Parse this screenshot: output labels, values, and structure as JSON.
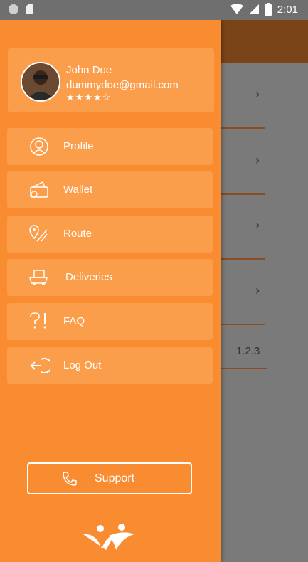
{
  "status_bar": {
    "time": "2:01"
  },
  "user": {
    "name": "John Doe",
    "email": "dummydoe@gmail.com",
    "rating": 4,
    "rating_max": 5,
    "stars_display": "★★★★☆"
  },
  "menu": [
    {
      "label": "Profile",
      "icon": "user-circle-icon"
    },
    {
      "label": "Wallet",
      "icon": "wallet-icon"
    },
    {
      "label": "Route",
      "icon": "route-icon"
    },
    {
      "label": "Deliveries",
      "icon": "truck-icon"
    },
    {
      "label": "FAQ",
      "icon": "question-exclaim-icon"
    },
    {
      "label": "Log Out",
      "icon": "logout-icon"
    }
  ],
  "support": {
    "label": "Support",
    "icon": "phone-icon"
  },
  "background": {
    "version": "1.2.3"
  },
  "colors": {
    "drawer": "#f98b31",
    "card": "#fb9e4c",
    "appbar": "#7a4418",
    "divider": "#8a4c20"
  }
}
